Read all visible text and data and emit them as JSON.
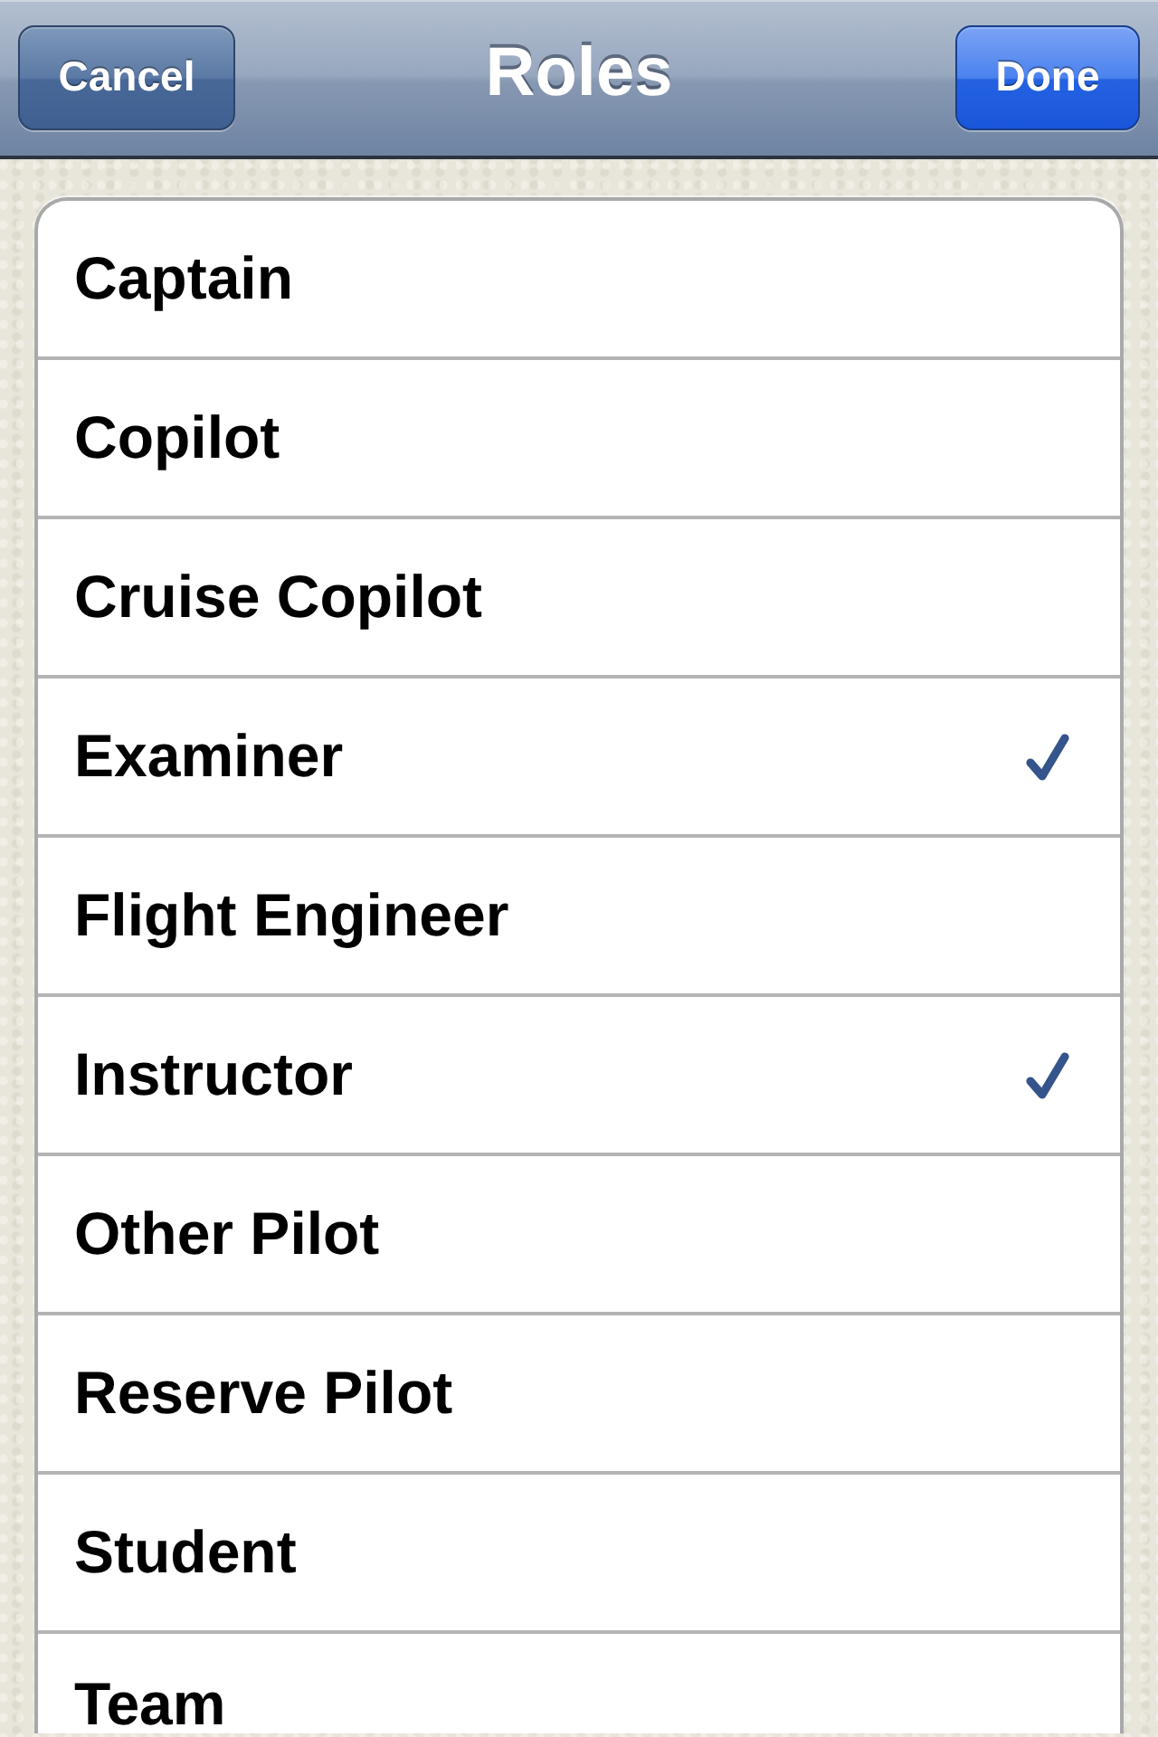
{
  "nav_bar": {
    "title": "Roles",
    "left_button": {
      "label": "Cancel"
    },
    "right_button": {
      "label": "Done"
    }
  },
  "roles": [
    {
      "label": "Captain",
      "checked": false
    },
    {
      "label": "Copilot",
      "checked": false
    },
    {
      "label": "Cruise Copilot",
      "checked": false
    },
    {
      "label": "Examiner",
      "checked": true
    },
    {
      "label": "Flight Engineer",
      "checked": false
    },
    {
      "label": "Instructor",
      "checked": true
    },
    {
      "label": "Other Pilot",
      "checked": false
    },
    {
      "label": "Reserve Pilot",
      "checked": false
    },
    {
      "label": "Student",
      "checked": false
    },
    {
      "label": "Team",
      "checked": false
    }
  ]
}
